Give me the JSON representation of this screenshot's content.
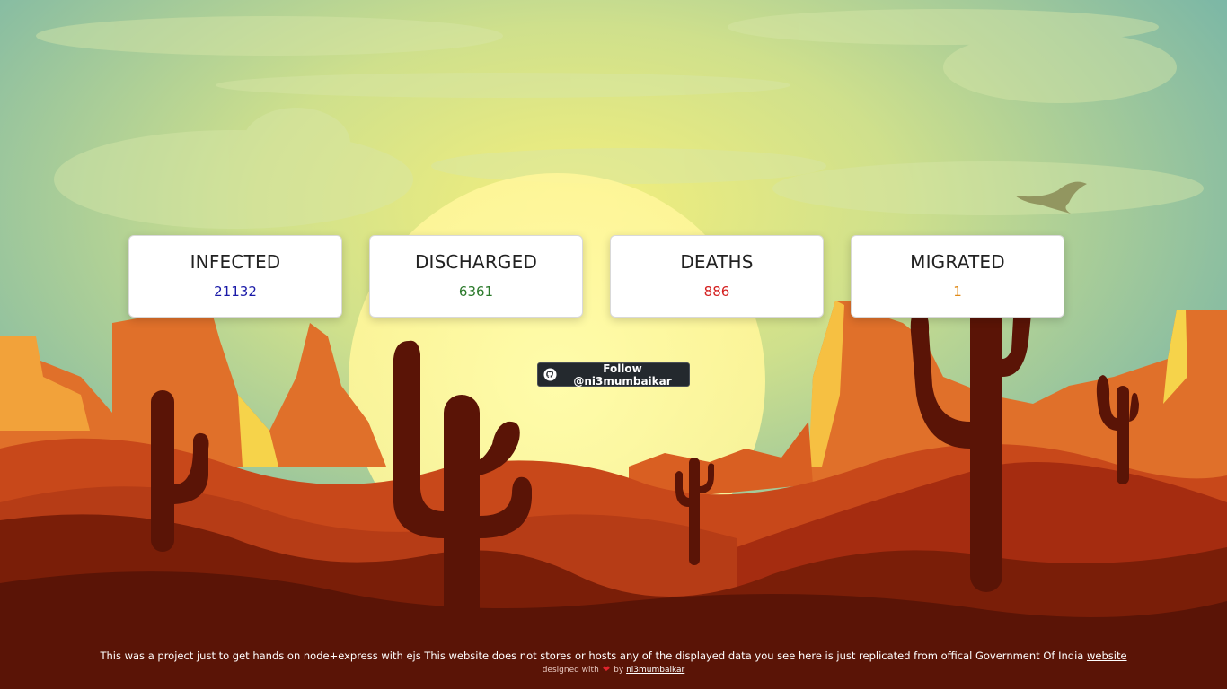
{
  "stats": {
    "infected": {
      "label": "INFECTED",
      "value": "21132"
    },
    "discharged": {
      "label": "DISCHARGED",
      "value": "6361"
    },
    "deaths": {
      "label": "DEATHS",
      "value": "886"
    },
    "migrated": {
      "label": "MIGRATED",
      "value": "1"
    }
  },
  "follow_button": {
    "label": "Follow @ni3mumbaikar",
    "icon": "github-icon"
  },
  "footer": {
    "text": "This was a project just to get hands on node+express with ejs This website does not stores or hosts any of the displayed data you see here is just replicated from offical Government Of India",
    "link_label": "website",
    "designed_with": "designed with",
    "heart": "❤",
    "by": "by",
    "author_link": "ni3mumbaikar"
  },
  "colors": {
    "infected": "#1a1aa8",
    "discharged": "#2c7a2c",
    "deaths": "#d42020",
    "migrated": "#e08a18",
    "button_bg": "#24292e"
  }
}
